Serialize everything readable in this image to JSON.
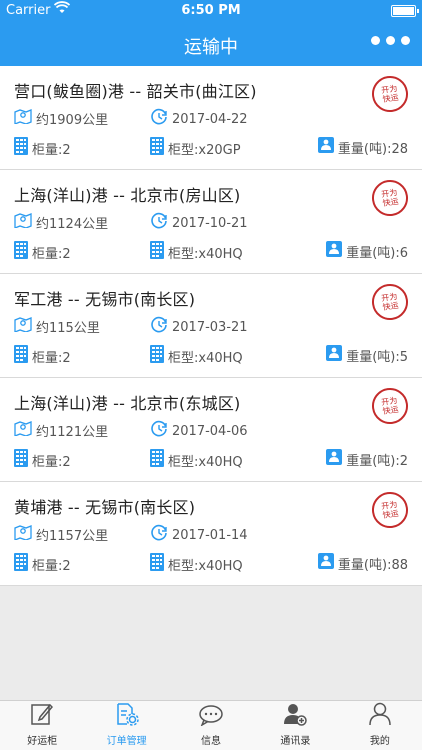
{
  "status": {
    "carrier": "Carrier",
    "time": "6:50 PM"
  },
  "nav": {
    "title": "运输中",
    "more_icon": "more-dots-icon"
  },
  "colors": {
    "primary": "#2b9bf0",
    "stamp": "#c42b2b"
  },
  "orders": [
    {
      "route": "营口(鲅鱼圈)港 -- 韶关市(曲江区)",
      "distance": "约1909公里",
      "date": "2017-04-22",
      "count": "柜量:2",
      "type": "柜型:x20GP",
      "weight": "重量(吨):28",
      "stamp": "开为快运"
    },
    {
      "route": "上海(洋山)港 -- 北京市(房山区)",
      "distance": "约1124公里",
      "date": "2017-10-21",
      "count": "柜量:2",
      "type": "柜型:x40HQ",
      "weight": "重量(吨):6",
      "stamp": "开为快运"
    },
    {
      "route": "军工港 -- 无锡市(南长区)",
      "distance": "约115公里",
      "date": "2017-03-21",
      "count": "柜量:2",
      "type": "柜型:x40HQ",
      "weight": "重量(吨):5",
      "stamp": "开为快运"
    },
    {
      "route": "上海(洋山)港 -- 北京市(东城区)",
      "distance": "约1121公里",
      "date": "2017-04-06",
      "count": "柜量:2",
      "type": "柜型:x40HQ",
      "weight": "重量(吨):2",
      "stamp": "开为快运"
    },
    {
      "route": "黄埔港 -- 无锡市(南长区)",
      "distance": "约1157公里",
      "date": "2017-01-14",
      "count": "柜量:2",
      "type": "柜型:x40HQ",
      "weight": "重量(吨):88",
      "stamp": "开为快运"
    }
  ],
  "tabs": [
    {
      "label": "好运柜",
      "icon": "edit-icon",
      "active": false
    },
    {
      "label": "订单管理",
      "icon": "order-settings-icon",
      "active": true
    },
    {
      "label": "信息",
      "icon": "chat-icon",
      "active": false
    },
    {
      "label": "通讯录",
      "icon": "contacts-icon",
      "active": false
    },
    {
      "label": "我的",
      "icon": "person-icon",
      "active": false
    }
  ]
}
